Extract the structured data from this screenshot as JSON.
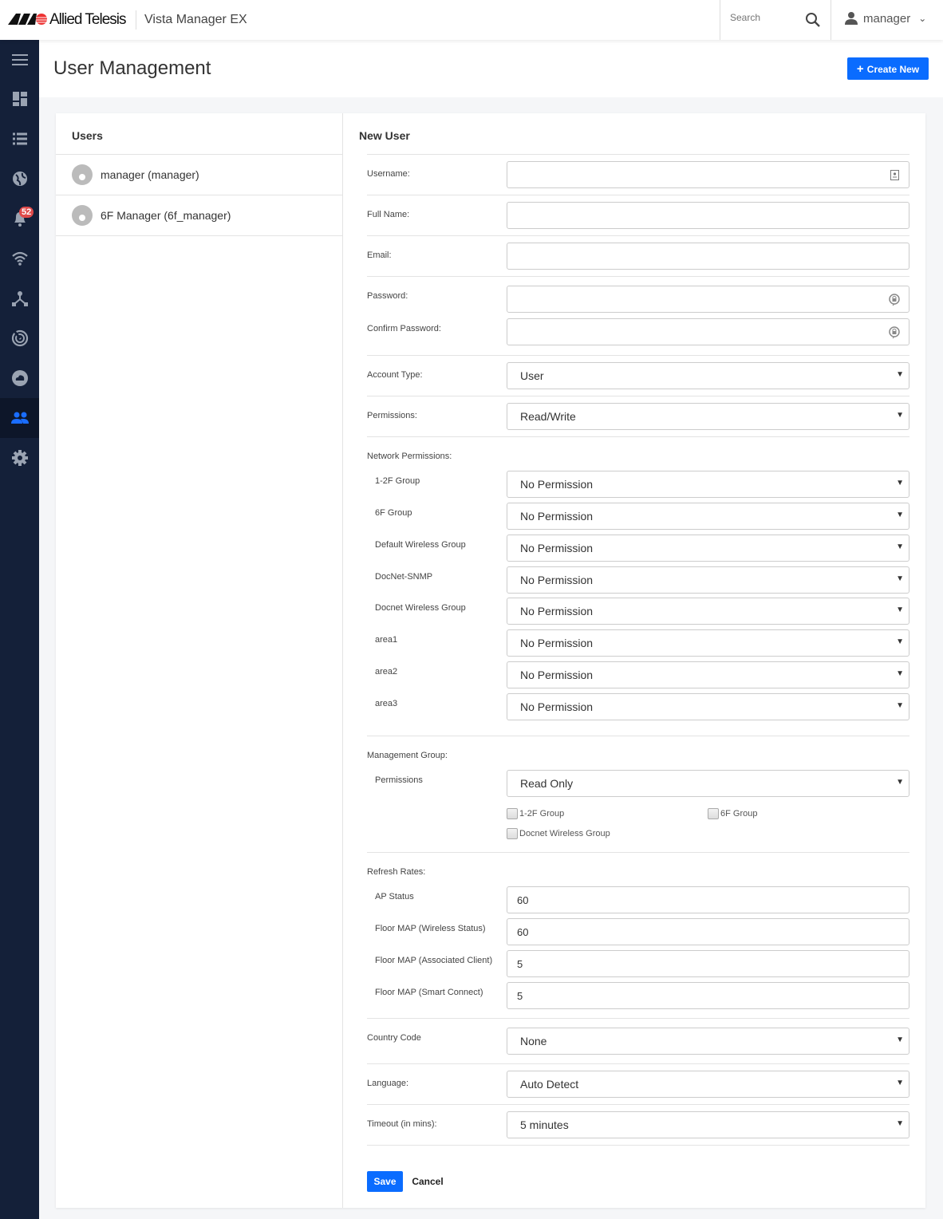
{
  "header": {
    "brand": "Allied Telesis",
    "app_title": "Vista Manager EX",
    "search_placeholder": "Search",
    "user": "manager"
  },
  "sidebar": {
    "items": [
      {
        "icon": "menu-icon"
      },
      {
        "icon": "dashboard-icon"
      },
      {
        "icon": "list-icon"
      },
      {
        "icon": "globe-icon"
      },
      {
        "icon": "bell-icon",
        "badge": "52"
      },
      {
        "icon": "wifi-icon"
      },
      {
        "icon": "topology-icon"
      },
      {
        "icon": "radar-icon"
      },
      {
        "icon": "cloud-icon"
      },
      {
        "icon": "users-icon",
        "active": true
      },
      {
        "icon": "gear-icon"
      }
    ]
  },
  "page": {
    "title": "User Management",
    "create_button": "Create New",
    "accent": "#0a6cff"
  },
  "users": {
    "heading": "Users",
    "items": [
      "manager (manager)",
      "6F Manager (6f_manager)"
    ]
  },
  "form": {
    "heading": "New User",
    "username_label": "Username:",
    "fullname_label": "Full Name:",
    "email_label": "Email:",
    "password_label": "Password:",
    "confirm_label": "Confirm Password:",
    "account_type_label": "Account Type:",
    "account_type": "User",
    "permissions_label": "Permissions:",
    "permissions": "Read/Write",
    "network_permissions_label": "Network Permissions:",
    "network_groups": [
      {
        "name": "1-2F Group",
        "value": "No Permission"
      },
      {
        "name": "6F Group",
        "value": "No Permission"
      },
      {
        "name": "Default Wireless Group",
        "value": "No Permission"
      },
      {
        "name": "DocNet-SNMP",
        "value": "No Permission"
      },
      {
        "name": "Docnet Wireless Group",
        "value": "No Permission"
      },
      {
        "name": "area1",
        "value": "No Permission"
      },
      {
        "name": "area2",
        "value": "No Permission"
      },
      {
        "name": "area3",
        "value": "No Permission"
      }
    ],
    "management_group_label": "Management Group:",
    "mg_permissions_label": "Permissions",
    "mg_permissions": "Read Only",
    "mg_groups": [
      {
        "name": "1-2F Group",
        "checked": false
      },
      {
        "name": "6F Group",
        "checked": false
      },
      {
        "name": "Docnet Wireless Group",
        "checked": false
      }
    ],
    "refresh_rates_label": "Refresh Rates:",
    "refresh": [
      {
        "name": "AP Status",
        "value": "60"
      },
      {
        "name": "Floor MAP (Wireless Status)",
        "value": "60"
      },
      {
        "name": "Floor MAP (Associated Client)",
        "value": "5"
      },
      {
        "name": "Floor MAP (Smart Connect)",
        "value": "5"
      }
    ],
    "country_label": "Country Code",
    "country": "None",
    "language_label": "Language:",
    "language": "Auto Detect",
    "timeout_label": "Timeout (in mins):",
    "timeout": "5 minutes",
    "save": "Save",
    "cancel": "Cancel"
  }
}
